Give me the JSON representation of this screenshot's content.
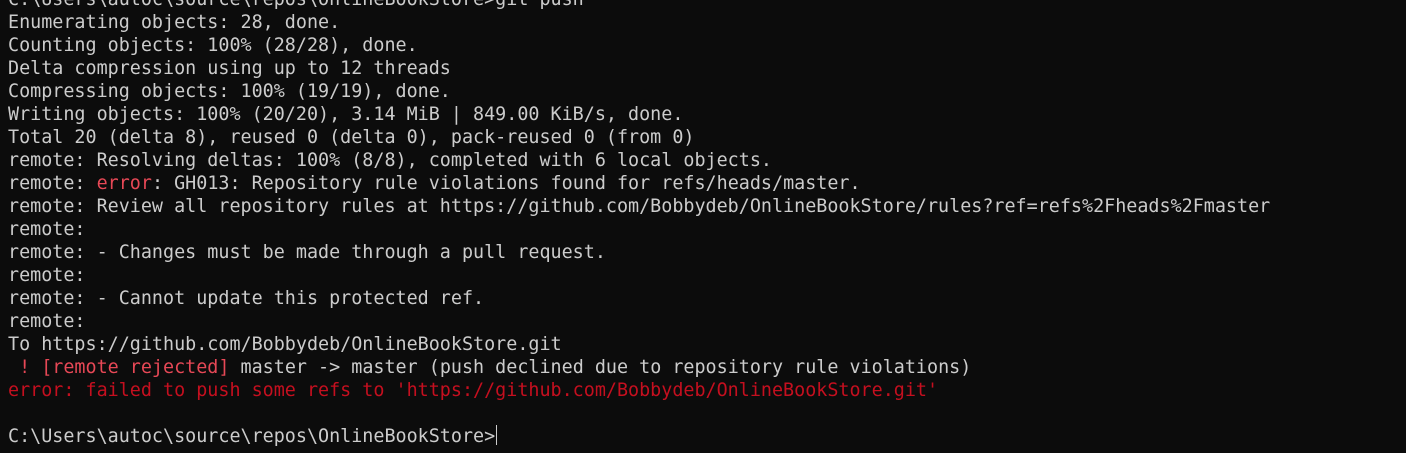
{
  "terminal": {
    "colors": {
      "background": "#0c0c0c",
      "foreground": "#cccccc",
      "error_red": "#e74856",
      "dark_red": "#c50f1f"
    },
    "lines": [
      {
        "segments": [
          {
            "text": "C:\\Users\\autoc\\source\\repos\\OnlineBookStore>git push",
            "color": "default"
          }
        ]
      },
      {
        "segments": [
          {
            "text": "Enumerating objects: 28, done.",
            "color": "default"
          }
        ]
      },
      {
        "segments": [
          {
            "text": "Counting objects: 100% (28/28), done.",
            "color": "default"
          }
        ]
      },
      {
        "segments": [
          {
            "text": "Delta compression using up to 12 threads",
            "color": "default"
          }
        ]
      },
      {
        "segments": [
          {
            "text": "Compressing objects: 100% (19/19), done.",
            "color": "default"
          }
        ]
      },
      {
        "segments": [
          {
            "text": "Writing objects: 100% (20/20), 3.14 MiB | 849.00 KiB/s, done.",
            "color": "default"
          }
        ]
      },
      {
        "segments": [
          {
            "text": "Total 20 (delta 8), reused 0 (delta 0), pack-reused 0 (from 0)",
            "color": "default"
          }
        ]
      },
      {
        "segments": [
          {
            "text": "remote: Resolving deltas: 100% (8/8), completed with 6 local objects.",
            "color": "default"
          }
        ]
      },
      {
        "segments": [
          {
            "text": "remote: ",
            "color": "default"
          },
          {
            "text": "error",
            "color": "red"
          },
          {
            "text": ": GH013: Repository rule violations found for refs/heads/master.",
            "color": "default"
          }
        ]
      },
      {
        "segments": [
          {
            "text": "remote: Review all repository rules at https://github.com/Bobbydeb/OnlineBookStore/rules?ref=refs%2Fheads%2Fmaster",
            "color": "default"
          }
        ]
      },
      {
        "segments": [
          {
            "text": "remote:",
            "color": "default"
          }
        ]
      },
      {
        "segments": [
          {
            "text": "remote: - Changes must be made through a pull request.",
            "color": "default"
          }
        ]
      },
      {
        "segments": [
          {
            "text": "remote:",
            "color": "default"
          }
        ]
      },
      {
        "segments": [
          {
            "text": "remote: - Cannot update this protected ref.",
            "color": "default"
          }
        ]
      },
      {
        "segments": [
          {
            "text": "remote:",
            "color": "default"
          }
        ]
      },
      {
        "segments": [
          {
            "text": "To https://github.com/Bobbydeb/OnlineBookStore.git",
            "color": "default"
          }
        ]
      },
      {
        "segments": [
          {
            "text": " ! [remote rejected]",
            "color": "red"
          },
          {
            "text": " master -> master (push declined due to repository rule violations)",
            "color": "default"
          }
        ]
      },
      {
        "segments": [
          {
            "text": "error: failed to push some refs to 'https://github.com/Bobbydeb/OnlineBookStore.git'",
            "color": "darkred"
          }
        ]
      },
      {
        "segments": [
          {
            "text": "",
            "color": "default"
          }
        ]
      },
      {
        "segments": [
          {
            "text": "C:\\Users\\autoc\\source\\repos\\OnlineBookStore>",
            "color": "default"
          }
        ],
        "cursor": true
      }
    ]
  }
}
